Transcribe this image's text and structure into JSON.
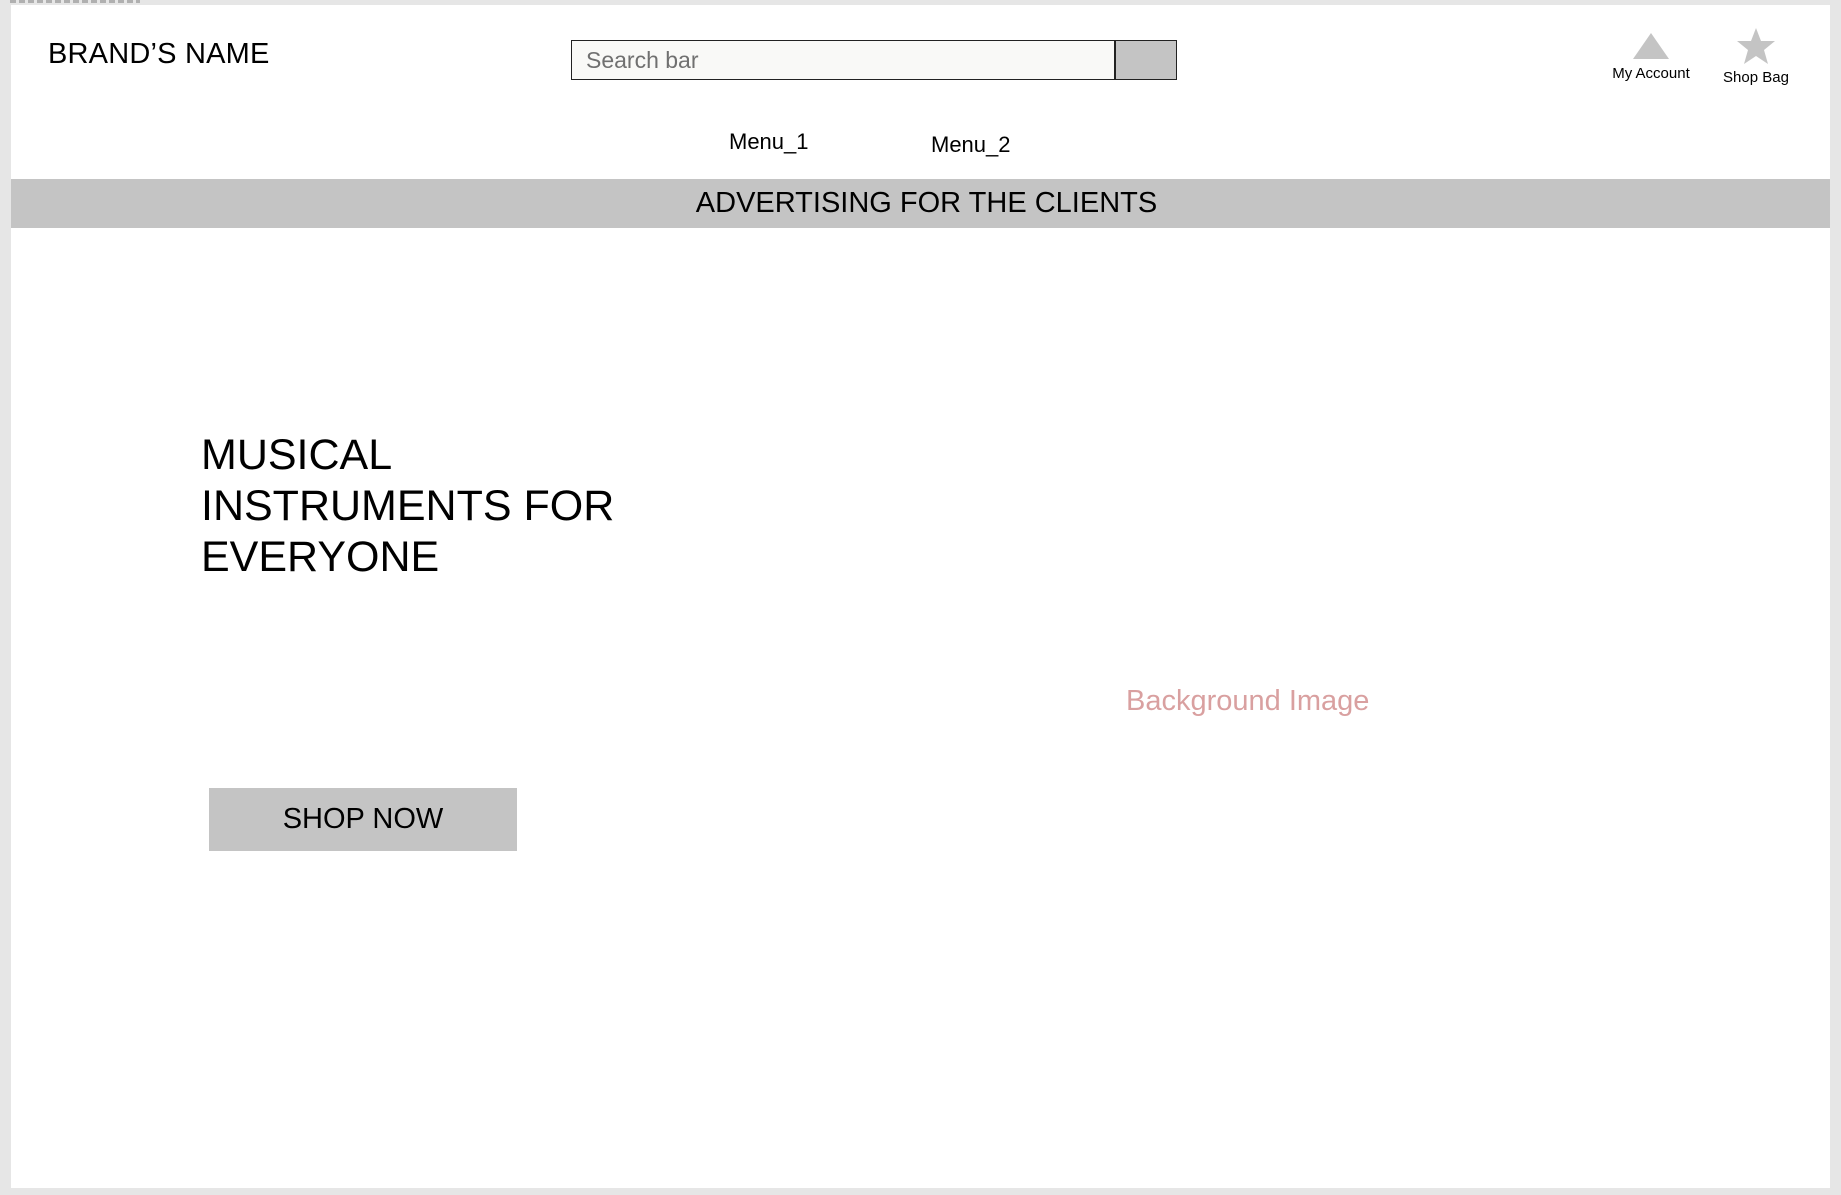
{
  "header": {
    "brand_name": "BRAND’S NAME",
    "search": {
      "placeholder": "Search bar",
      "value": ""
    },
    "account": {
      "label": "My Account",
      "icon": "triangle-icon"
    },
    "bag": {
      "label": "Shop Bag",
      "icon": "star-icon"
    }
  },
  "nav": {
    "items": [
      {
        "label": "Menu_1"
      },
      {
        "label": "Menu_2"
      }
    ]
  },
  "banner": {
    "text": "ADVERTISING FOR THE CLIENTS"
  },
  "hero": {
    "headline": "MUSICAL\nINSTRUMENTS FOR\nEVERYONE",
    "background_label": "Background Image",
    "cta_label": "SHOP NOW"
  },
  "colors": {
    "page_bg": "#e6e6e6",
    "canvas": "#ffffff",
    "placeholder_gray": "#c4c4c4",
    "background_label": "#d9a0a0"
  }
}
